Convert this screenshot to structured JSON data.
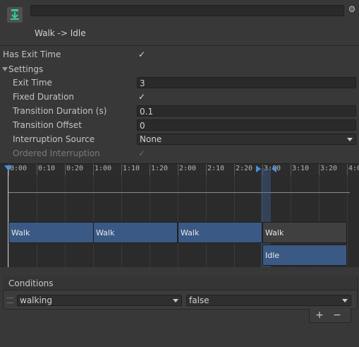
{
  "header": {
    "icon": "download-arrow-icon",
    "name_value": "",
    "settings_icon": "gear-icon",
    "title": "Walk -> Idle"
  },
  "has_exit_time": {
    "label": "Has Exit Time",
    "checked": true,
    "mark": "✓"
  },
  "settings": {
    "label": "Settings",
    "expanded": true,
    "exit_time": {
      "label": "Exit Time",
      "value": "3"
    },
    "fixed_duration": {
      "label": "Fixed Duration",
      "checked": true,
      "mark": "✓"
    },
    "transition_duration": {
      "label": "Transition Duration (s)",
      "value": "0.1"
    },
    "transition_offset": {
      "label": "Transition Offset",
      "value": "0"
    },
    "interruption_source": {
      "label": "Interruption Source",
      "value": "None"
    },
    "ordered_interruption": {
      "label": "Ordered Interruption",
      "checked": true,
      "mark": "✓",
      "disabled": true
    }
  },
  "timeline": {
    "ticks": [
      "0:00",
      "0:10",
      "0:20",
      "1:00",
      "1:10",
      "1:20",
      "2:00",
      "2:10",
      "2:20",
      "3:00",
      "3:10",
      "3:20",
      "4:0"
    ],
    "clips": [
      "Walk",
      "Walk",
      "Walk",
      "Walk"
    ],
    "next_clip": "Idle",
    "colors": {
      "clip": "#3a5a85",
      "marker": "#4d8fd6"
    }
  },
  "conditions": {
    "title": "Conditions",
    "rows": [
      {
        "parameter": "walking",
        "value": "false"
      }
    ],
    "add_label": "+",
    "remove_label": "−"
  }
}
